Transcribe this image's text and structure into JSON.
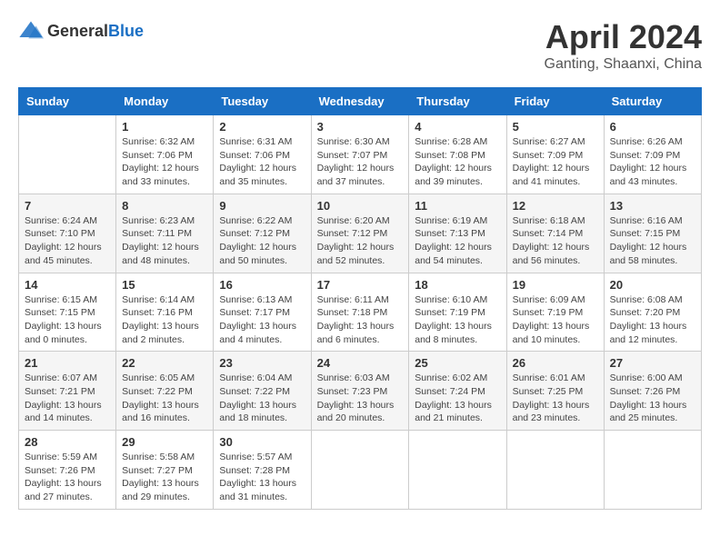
{
  "header": {
    "logo_general": "General",
    "logo_blue": "Blue",
    "title": "April 2024",
    "subtitle": "Ganting, Shaanxi, China"
  },
  "calendar": {
    "days_of_week": [
      "Sunday",
      "Monday",
      "Tuesday",
      "Wednesday",
      "Thursday",
      "Friday",
      "Saturday"
    ],
    "weeks": [
      [
        {
          "day": "",
          "sunrise": "",
          "sunset": "",
          "daylight": ""
        },
        {
          "day": "1",
          "sunrise": "Sunrise: 6:32 AM",
          "sunset": "Sunset: 7:06 PM",
          "daylight": "Daylight: 12 hours and 33 minutes."
        },
        {
          "day": "2",
          "sunrise": "Sunrise: 6:31 AM",
          "sunset": "Sunset: 7:06 PM",
          "daylight": "Daylight: 12 hours and 35 minutes."
        },
        {
          "day": "3",
          "sunrise": "Sunrise: 6:30 AM",
          "sunset": "Sunset: 7:07 PM",
          "daylight": "Daylight: 12 hours and 37 minutes."
        },
        {
          "day": "4",
          "sunrise": "Sunrise: 6:28 AM",
          "sunset": "Sunset: 7:08 PM",
          "daylight": "Daylight: 12 hours and 39 minutes."
        },
        {
          "day": "5",
          "sunrise": "Sunrise: 6:27 AM",
          "sunset": "Sunset: 7:09 PM",
          "daylight": "Daylight: 12 hours and 41 minutes."
        },
        {
          "day": "6",
          "sunrise": "Sunrise: 6:26 AM",
          "sunset": "Sunset: 7:09 PM",
          "daylight": "Daylight: 12 hours and 43 minutes."
        }
      ],
      [
        {
          "day": "7",
          "sunrise": "Sunrise: 6:24 AM",
          "sunset": "Sunset: 7:10 PM",
          "daylight": "Daylight: 12 hours and 45 minutes."
        },
        {
          "day": "8",
          "sunrise": "Sunrise: 6:23 AM",
          "sunset": "Sunset: 7:11 PM",
          "daylight": "Daylight: 12 hours and 48 minutes."
        },
        {
          "day": "9",
          "sunrise": "Sunrise: 6:22 AM",
          "sunset": "Sunset: 7:12 PM",
          "daylight": "Daylight: 12 hours and 50 minutes."
        },
        {
          "day": "10",
          "sunrise": "Sunrise: 6:20 AM",
          "sunset": "Sunset: 7:12 PM",
          "daylight": "Daylight: 12 hours and 52 minutes."
        },
        {
          "day": "11",
          "sunrise": "Sunrise: 6:19 AM",
          "sunset": "Sunset: 7:13 PM",
          "daylight": "Daylight: 12 hours and 54 minutes."
        },
        {
          "day": "12",
          "sunrise": "Sunrise: 6:18 AM",
          "sunset": "Sunset: 7:14 PM",
          "daylight": "Daylight: 12 hours and 56 minutes."
        },
        {
          "day": "13",
          "sunrise": "Sunrise: 6:16 AM",
          "sunset": "Sunset: 7:15 PM",
          "daylight": "Daylight: 12 hours and 58 minutes."
        }
      ],
      [
        {
          "day": "14",
          "sunrise": "Sunrise: 6:15 AM",
          "sunset": "Sunset: 7:15 PM",
          "daylight": "Daylight: 13 hours and 0 minutes."
        },
        {
          "day": "15",
          "sunrise": "Sunrise: 6:14 AM",
          "sunset": "Sunset: 7:16 PM",
          "daylight": "Daylight: 13 hours and 2 minutes."
        },
        {
          "day": "16",
          "sunrise": "Sunrise: 6:13 AM",
          "sunset": "Sunset: 7:17 PM",
          "daylight": "Daylight: 13 hours and 4 minutes."
        },
        {
          "day": "17",
          "sunrise": "Sunrise: 6:11 AM",
          "sunset": "Sunset: 7:18 PM",
          "daylight": "Daylight: 13 hours and 6 minutes."
        },
        {
          "day": "18",
          "sunrise": "Sunrise: 6:10 AM",
          "sunset": "Sunset: 7:19 PM",
          "daylight": "Daylight: 13 hours and 8 minutes."
        },
        {
          "day": "19",
          "sunrise": "Sunrise: 6:09 AM",
          "sunset": "Sunset: 7:19 PM",
          "daylight": "Daylight: 13 hours and 10 minutes."
        },
        {
          "day": "20",
          "sunrise": "Sunrise: 6:08 AM",
          "sunset": "Sunset: 7:20 PM",
          "daylight": "Daylight: 13 hours and 12 minutes."
        }
      ],
      [
        {
          "day": "21",
          "sunrise": "Sunrise: 6:07 AM",
          "sunset": "Sunset: 7:21 PM",
          "daylight": "Daylight: 13 hours and 14 minutes."
        },
        {
          "day": "22",
          "sunrise": "Sunrise: 6:05 AM",
          "sunset": "Sunset: 7:22 PM",
          "daylight": "Daylight: 13 hours and 16 minutes."
        },
        {
          "day": "23",
          "sunrise": "Sunrise: 6:04 AM",
          "sunset": "Sunset: 7:22 PM",
          "daylight": "Daylight: 13 hours and 18 minutes."
        },
        {
          "day": "24",
          "sunrise": "Sunrise: 6:03 AM",
          "sunset": "Sunset: 7:23 PM",
          "daylight": "Daylight: 13 hours and 20 minutes."
        },
        {
          "day": "25",
          "sunrise": "Sunrise: 6:02 AM",
          "sunset": "Sunset: 7:24 PM",
          "daylight": "Daylight: 13 hours and 21 minutes."
        },
        {
          "day": "26",
          "sunrise": "Sunrise: 6:01 AM",
          "sunset": "Sunset: 7:25 PM",
          "daylight": "Daylight: 13 hours and 23 minutes."
        },
        {
          "day": "27",
          "sunrise": "Sunrise: 6:00 AM",
          "sunset": "Sunset: 7:26 PM",
          "daylight": "Daylight: 13 hours and 25 minutes."
        }
      ],
      [
        {
          "day": "28",
          "sunrise": "Sunrise: 5:59 AM",
          "sunset": "Sunset: 7:26 PM",
          "daylight": "Daylight: 13 hours and 27 minutes."
        },
        {
          "day": "29",
          "sunrise": "Sunrise: 5:58 AM",
          "sunset": "Sunset: 7:27 PM",
          "daylight": "Daylight: 13 hours and 29 minutes."
        },
        {
          "day": "30",
          "sunrise": "Sunrise: 5:57 AM",
          "sunset": "Sunset: 7:28 PM",
          "daylight": "Daylight: 13 hours and 31 minutes."
        },
        {
          "day": "",
          "sunrise": "",
          "sunset": "",
          "daylight": ""
        },
        {
          "day": "",
          "sunrise": "",
          "sunset": "",
          "daylight": ""
        },
        {
          "day": "",
          "sunrise": "",
          "sunset": "",
          "daylight": ""
        },
        {
          "day": "",
          "sunrise": "",
          "sunset": "",
          "daylight": ""
        }
      ]
    ]
  }
}
